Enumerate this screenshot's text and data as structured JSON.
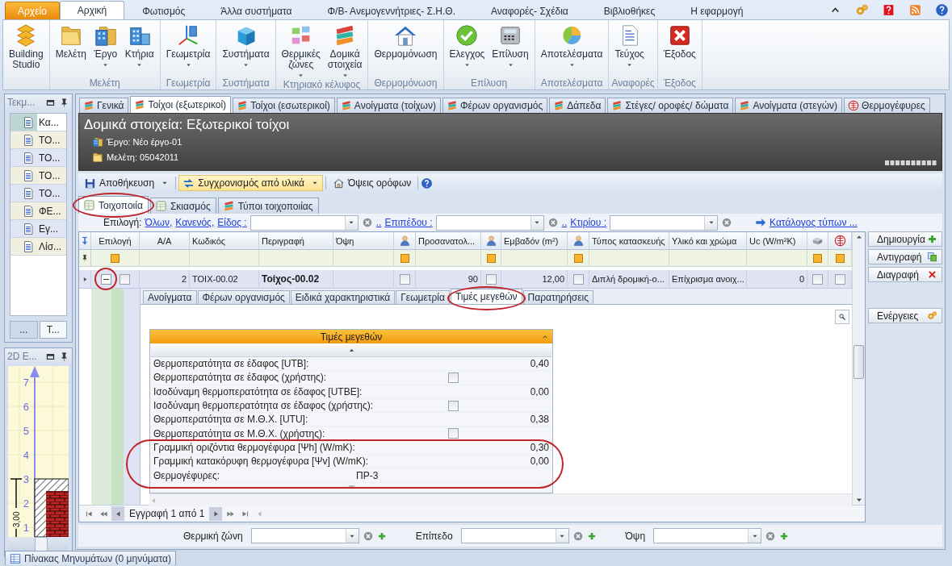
{
  "ribbon": {
    "tabs": [
      {
        "label": "Αρχείο",
        "kind": "file",
        "selected": false
      },
      {
        "label": "Αρχική",
        "kind": "tab",
        "selected": true
      },
      {
        "label": "Φωτισμός",
        "kind": "tab",
        "selected": false
      },
      {
        "label": "Άλλα συστήματα",
        "kind": "tab",
        "selected": false
      },
      {
        "label": "Φ/Β- Ανεμογεννήτριες- Σ.Η.Θ.",
        "kind": "tab",
        "selected": false
      },
      {
        "label": "Αναφορές- Σχέδια",
        "kind": "tab",
        "selected": false
      },
      {
        "label": "Βιβλιοθήκες",
        "kind": "tab",
        "selected": false
      },
      {
        "label": "Η εφαρμογή",
        "kind": "tab",
        "selected": false
      }
    ],
    "groups": [
      {
        "buttons": [
          {
            "label": "Building Studio",
            "dropdown": false
          }
        ]
      },
      {
        "label": "Μελέτη",
        "buttons": [
          {
            "label": "Μελέτη",
            "dropdown": false
          },
          {
            "label": "Έργο",
            "dropdown": true
          },
          {
            "label": "Κτήρια",
            "dropdown": true
          }
        ]
      },
      {
        "label": "Γεωμετρία",
        "buttons": [
          {
            "label": "Γεωμετρία",
            "dropdown": true
          }
        ]
      },
      {
        "label": "Συστήματα",
        "buttons": [
          {
            "label": "Συστήματα",
            "dropdown": true
          }
        ]
      },
      {
        "label": "Κτηριακό κέλυφος",
        "buttons": [
          {
            "label": "Θερμικές ζώνες",
            "dropdown": true
          },
          {
            "label": "Δομικά στοιχεία",
            "dropdown": true
          }
        ]
      },
      {
        "label": "Θερμομόνωση",
        "buttons": [
          {
            "label": "Θερμομόνωση",
            "dropdown": false
          }
        ]
      },
      {
        "label": "Επίλυση",
        "buttons": [
          {
            "label": "Ελεγχος",
            "dropdown": true
          },
          {
            "label": "Επίλυση",
            "dropdown": true
          }
        ]
      },
      {
        "label": "Αποτελέσματα",
        "buttons": [
          {
            "label": "Αποτελέσματα",
            "dropdown": true
          }
        ]
      },
      {
        "label": "Αναφορές",
        "buttons": [
          {
            "label": "Τεύχος",
            "dropdown": true
          }
        ]
      },
      {
        "label": "Έξοδος",
        "buttons": [
          {
            "label": "Έξοδος",
            "dropdown": false
          }
        ]
      }
    ]
  },
  "side_panel": {
    "title": "Τεκμ...",
    "items": [
      {
        "label": "Κα...",
        "selected": true
      },
      {
        "label": "ΤΟ...",
        "selected": false
      },
      {
        "label": "ΤΟ...",
        "selected": false
      },
      {
        "label": "ΤΟ...",
        "selected": false
      },
      {
        "label": "ΤΟ...",
        "selected": false
      },
      {
        "label": "ΦΕ...",
        "selected": false
      },
      {
        "label": "Εγ...",
        "selected": false
      },
      {
        "label": "Λίσ...",
        "selected": false
      }
    ],
    "tabs": [
      {
        "label": "...",
        "selected": false
      },
      {
        "label": "Τ...",
        "selected": true
      }
    ]
  },
  "drawing_panel": {
    "title": "2D E...",
    "axis_labels": [
      "7",
      "6",
      "5",
      "4",
      "3",
      "2",
      "1"
    ],
    "dimension": "3,00"
  },
  "doc": {
    "tabs": [
      {
        "label": "Γενικά",
        "selected": false
      },
      {
        "label": "Τοίχοι (εξωτερικοί)",
        "selected": true
      },
      {
        "label": "Τοίχοι (εσωτερικοί)",
        "selected": false
      },
      {
        "label": "Ανοίγματα (τοίχων)",
        "selected": false
      },
      {
        "label": "Φέρων οργανισμός",
        "selected": false
      },
      {
        "label": "Δάπεδα",
        "selected": false
      },
      {
        "label": "Στέγες/ οροφές/ δώματα",
        "selected": false
      },
      {
        "label": "Ανοίγματα (στεγών)",
        "selected": false
      },
      {
        "label": "Θερμογέφυρες",
        "selected": false
      }
    ],
    "title": "Δομικά στοιχεία: Εξωτερικοί τοίχοι",
    "project": "Έργο: Νέο έργο-01",
    "study": "Μελέτη: 05042011",
    "toolbar": [
      {
        "label": "Αποθήκευση",
        "dropdown": true,
        "highlighted": false
      },
      {
        "label": "Συγχρονισμός από υλικά",
        "dropdown": true,
        "highlighted": true
      },
      {
        "label": "Όψεις ορόφων",
        "dropdown": false,
        "highlighted": false
      }
    ],
    "subtabs": [
      {
        "label": "Τοιχοποιία",
        "selected": true
      },
      {
        "label": "Σκιασμός",
        "selected": false
      },
      {
        "label": "Τύποι τοιχοποιίας",
        "selected": false
      }
    ]
  },
  "filter": {
    "label": "Επιλογή:",
    "links": [
      "Όλων,",
      "Κανενός,"
    ],
    "combos": [
      {
        "label": "Είδος :"
      },
      {
        "prefix": "..",
        "label": "Επιπέδου :"
      },
      {
        "prefix": "..",
        "label": "Κτιρίου :"
      }
    ],
    "catalog_link": "Κατάλογος τύπων ..."
  },
  "grid": {
    "columns": [
      {
        "kind": "text",
        "label": "Επιλογή",
        "filter_mark": true
      },
      {
        "kind": "text",
        "label": "Α/Α",
        "filter_mark": false
      },
      {
        "kind": "text",
        "label": "Κωδικός",
        "filter_mark": false
      },
      {
        "kind": "text",
        "label": "Περιγραφή",
        "filter_mark": false
      },
      {
        "kind": "text",
        "label": "Όψη",
        "filter_mark": false
      },
      {
        "kind": "icon",
        "filter_mark": true
      },
      {
        "kind": "text",
        "label": "Προσανατολ...",
        "filter_mark": false
      },
      {
        "kind": "icon",
        "filter_mark": true
      },
      {
        "kind": "text",
        "label": "Εμβαδόν (m²)",
        "filter_mark": false
      },
      {
        "kind": "icon",
        "filter_mark": true
      },
      {
        "kind": "text",
        "label": "Τύπος κατασκευής",
        "filter_mark": false
      },
      {
        "kind": "text",
        "label": "Υλικό και χρώμα",
        "filter_mark": false
      },
      {
        "kind": "text",
        "label": "Uc (W/m²K)",
        "filter_mark": false
      },
      {
        "kind": "icon",
        "filter_mark": true
      },
      {
        "kind": "icon",
        "filter_mark": true
      }
    ],
    "rows": [
      {
        "selected": true,
        "cells": [
          {
            "kind": "select",
            "expanded": true,
            "checked": false
          },
          {
            "kind": "text",
            "text": "2"
          },
          {
            "kind": "text",
            "text": "ΤΟΙΧ-00.02"
          },
          {
            "kind": "title",
            "text": "Τοίχος-00.02"
          },
          {
            "kind": "blank"
          },
          {
            "kind": "check",
            "checked": false
          },
          {
            "kind": "text",
            "text": "90"
          },
          {
            "kind": "check",
            "checked": false
          },
          {
            "kind": "text",
            "text": "12,00"
          },
          {
            "kind": "check",
            "checked": false
          },
          {
            "kind": "text",
            "text": "Διπλή δρομική-ο..."
          },
          {
            "kind": "text",
            "text": "Επίχρισμα ανοιχ..."
          },
          {
            "kind": "text",
            "text": "0"
          },
          {
            "kind": "check",
            "checked": false
          },
          {
            "kind": "check",
            "checked": false
          }
        ]
      }
    ]
  },
  "detail": {
    "tabs": [
      {
        "label": "Ανοίγματα",
        "selected": false
      },
      {
        "label": "Φέρων οργανισμός",
        "selected": false
      },
      {
        "label": "Ειδικά χαρακτηριστικά",
        "selected": false
      },
      {
        "label": "Γεωμετρία",
        "selected": false
      },
      {
        "label": "Τιμές μεγεθών",
        "selected": true
      },
      {
        "label": "Παρατηρήσεις",
        "selected": false
      }
    ],
    "panel": {
      "title": "Τιμές μεγεθών",
      "rows": [
        {
          "kind": "value",
          "label": "Θερμοπερατότητα σε έδαφος [UTB]:",
          "value": "0,40"
        },
        {
          "kind": "check",
          "label": "Θερμοπερατότητα σε έδαφος (χρήστης):",
          "checked": false
        },
        {
          "kind": "value",
          "label": "Ισοδύναμη θερμοπερατότητα σε έδαφος [UTBE]:",
          "value": "0,00"
        },
        {
          "kind": "check",
          "label": "Ισοδύναμη θερμοπερατότητα σε έδαφος (χρήστης):",
          "checked": false
        },
        {
          "kind": "value",
          "label": "Θερμοπερατότητα σε Μ.Θ.Χ. [UTU]:",
          "value": "0,38"
        },
        {
          "kind": "check",
          "label": "Θερμοπερατότητα σε Μ.Θ.Χ. (χρήστης):",
          "checked": false
        },
        {
          "kind": "value",
          "label": "Γραμμική οριζόντια θερμογέφυρα [Ψh] (W/mK):",
          "value": "0,30"
        },
        {
          "kind": "value",
          "label": "Γραμμική κατακόρυφη θερμογέφυρα [Ψv] (W/mK):",
          "value": "0,00"
        },
        {
          "kind": "ref",
          "label": "Θερμογέφυρες:",
          "value": "ΠΡ-3"
        }
      ]
    }
  },
  "navigator": {
    "text": "Εγγραφή 1 από 1"
  },
  "actions": [
    {
      "label": "Δημιουργία"
    },
    {
      "label": "Αντιγραφή"
    },
    {
      "label": "Διαγραφή"
    },
    {
      "label": "Ενέργειες"
    }
  ],
  "bottom_filter": [
    {
      "label": "Θερμική ζώνη"
    },
    {
      "label": "Επίπεδο"
    },
    {
      "label": "Όψη"
    }
  ],
  "status_bar": {
    "tab": "Πίνακας Μηνυμάτων (0 μηνύματα)"
  }
}
